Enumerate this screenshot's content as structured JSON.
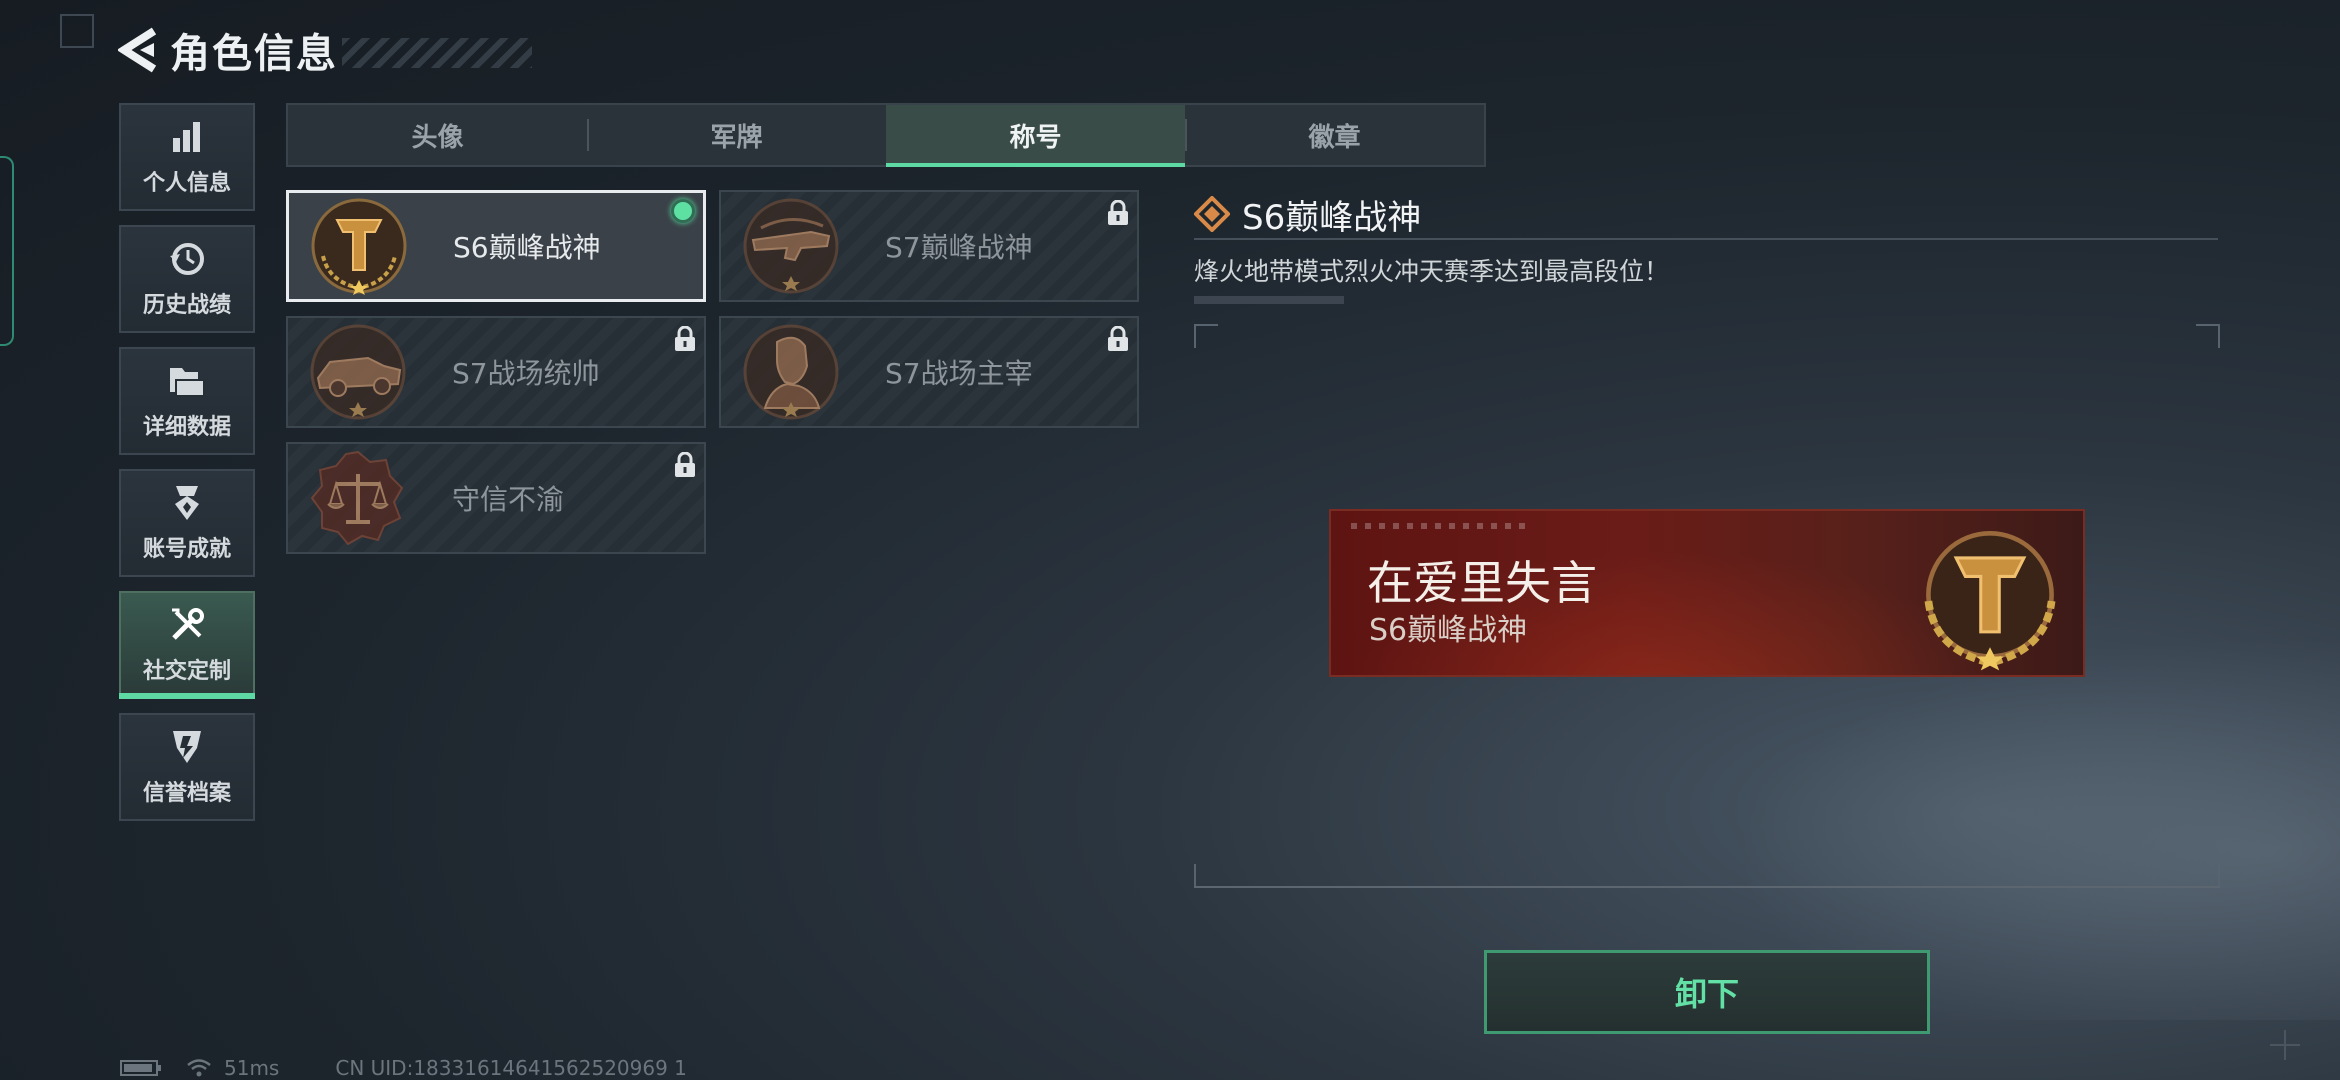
{
  "header": {
    "title": "角色信息"
  },
  "sidebar": {
    "items": [
      {
        "label": "个人信息",
        "icon": "bar-chart-icon"
      },
      {
        "label": "历史战绩",
        "icon": "clock-history-icon"
      },
      {
        "label": "详细数据",
        "icon": "folder-stack-icon"
      },
      {
        "label": "账号成就",
        "icon": "medal-icon"
      },
      {
        "label": "社交定制",
        "icon": "tools-icon",
        "active": true
      },
      {
        "label": "信誉档案",
        "icon": "shield-badge-icon"
      }
    ]
  },
  "tabs": [
    {
      "label": "头像"
    },
    {
      "label": "军牌"
    },
    {
      "label": "称号",
      "active": true
    },
    {
      "label": "徽章"
    }
  ],
  "titles": [
    {
      "name": "S6巅峰战神",
      "locked": false,
      "equipped": true
    },
    {
      "name": "S7巅峰战神",
      "locked": true
    },
    {
      "name": "S7战场统帅",
      "locked": true
    },
    {
      "name": "S7战场主宰",
      "locked": true
    },
    {
      "name": "守信不渝",
      "locked": true
    }
  ],
  "detail": {
    "title": "S6巅峰战神",
    "description": "烽火地带模式烈火冲天赛季达到最高段位！"
  },
  "banner": {
    "player_name": "在爱里失言",
    "title": "S6巅峰战神"
  },
  "actions": {
    "unequip_label": "卸下"
  },
  "status": {
    "ping": "51ms",
    "uid": "CN UID:18331614641562520969 1"
  },
  "colors": {
    "accent": "#5fd9a4",
    "banner_red": "#6a1c18",
    "gold": "#c9903e"
  }
}
